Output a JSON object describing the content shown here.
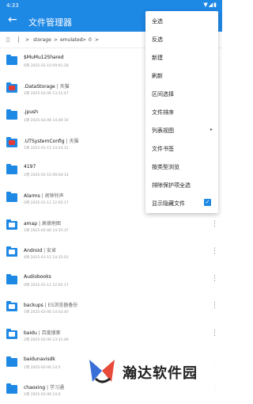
{
  "status": {
    "time": "4:33",
    "icons": "▼◢▮"
  },
  "appbar": {
    "title": "文件管理器"
  },
  "breadcrumb": {
    "segments": [
      "storage",
      "emulated",
      "0"
    ],
    "sep": ">"
  },
  "rows": [
    {
      "name": "$MuMu12Shared",
      "tag": "",
      "meta": "6项  2025-02-10 09:01:28",
      "badge": ""
    },
    {
      "name": ".DataStorage",
      "tag": "| 天猫",
      "meta": "1项  2025-02-06 13:31:47",
      "badge": "red"
    },
    {
      "name": ".jpush",
      "tag": "",
      "meta": "1项  2025-02-06 14:40:16",
      "badge": ""
    },
    {
      "name": ".UTSystemConfig",
      "tag": "| 天猫",
      "meta": "1项  2025-01-15 14:24:31",
      "badge": "red"
    },
    {
      "name": "4197",
      "tag": "",
      "meta": "1项  2025-02-10 09:04:14",
      "badge": ""
    },
    {
      "name": "Alarms",
      "tag": "| 闹钟铃声",
      "meta": "0项  2025-01-11 12:05:17",
      "badge": ""
    },
    {
      "name": "amap",
      "tag": "| 高德地图",
      "meta": "1项  2025-02-06 14:35:37",
      "badge": "blue"
    },
    {
      "name": "Android",
      "tag": "| 安卓",
      "meta": "4项  2025-01-15 14:35:03",
      "badge": "blue"
    },
    {
      "name": "Audiobooks",
      "tag": "",
      "meta": "0项  2025-01-11 12:05:17",
      "badge": ""
    },
    {
      "name": "backups",
      "tag": "| ES浏览器备份",
      "meta": "1项  2025-02-06 14:03:40",
      "badge": "blue"
    },
    {
      "name": "baidu",
      "tag": "| 百度搜索",
      "meta": "2项  2025-02-06 13:31:48",
      "badge": "blue"
    },
    {
      "name": "baidunavisdk",
      "tag": "",
      "meta": "1项  2025-02-06 14:5",
      "badge": ""
    },
    {
      "name": "chaoxing",
      "tag": "| 学习通",
      "meta": "1项  2025-02-06 14:0",
      "badge": ""
    }
  ],
  "menu": {
    "items": [
      {
        "label": "全选"
      },
      {
        "label": "反选"
      },
      {
        "label": "新建"
      },
      {
        "label": "刷新"
      },
      {
        "label": "区间选择"
      },
      {
        "label": "文件排序"
      },
      {
        "label": "列表视图",
        "submenu": "▸"
      },
      {
        "label": "文件书签"
      },
      {
        "label": "按类型浏览"
      },
      {
        "label": "排除保护项全选"
      },
      {
        "label": "显示隐藏文件",
        "checked": "✓"
      }
    ]
  },
  "watermark": {
    "text": "瀚达软件园"
  }
}
